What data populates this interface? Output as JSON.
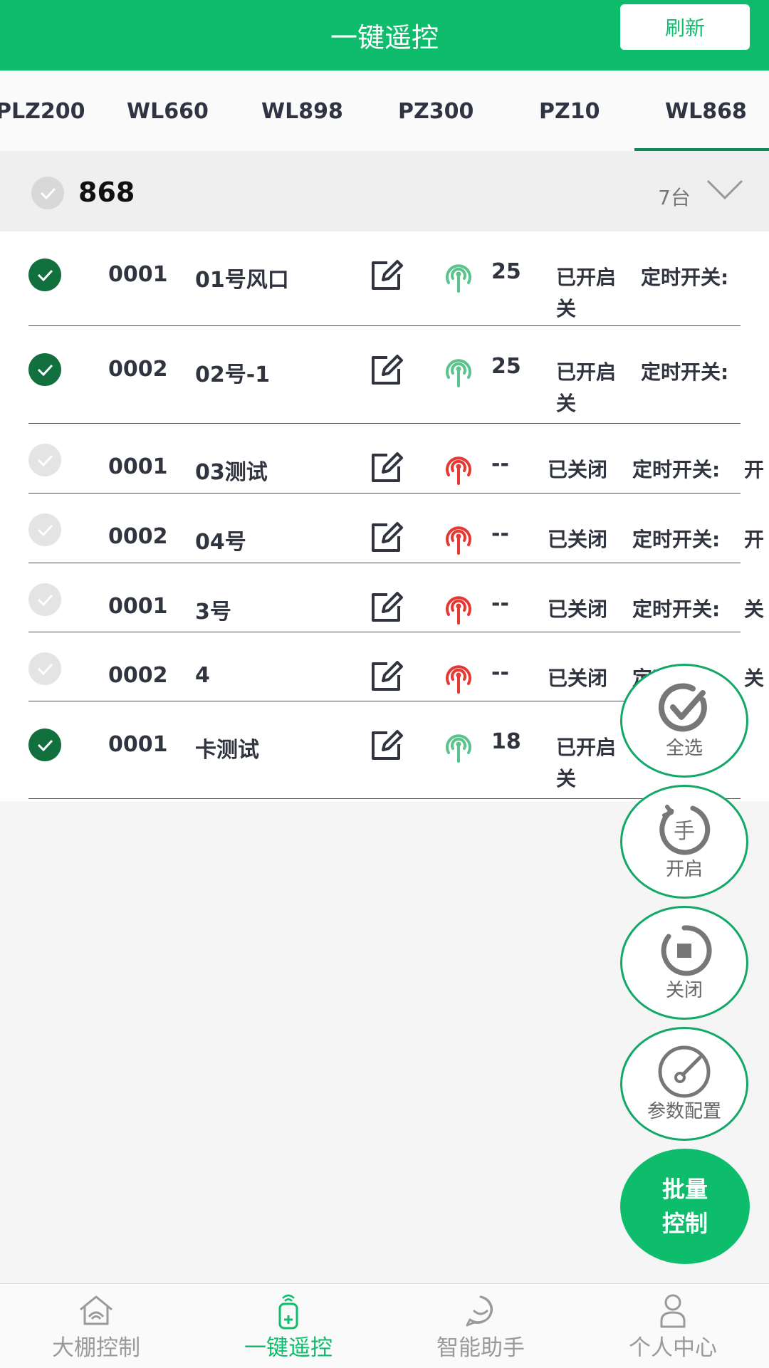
{
  "header": {
    "title": "一键遥控",
    "refresh_label": "刷新"
  },
  "tabs": [
    "PLZ200",
    "WL660",
    "WL898",
    "PZ300",
    "PZ10",
    "WL868"
  ],
  "active_tab": "WL868",
  "group": {
    "name": "868",
    "count": "7台"
  },
  "devices": [
    {
      "checked": true,
      "code": "0001",
      "name": "01号风口",
      "signal": "good",
      "value": "25",
      "status": "已开启",
      "timer_label": "定时开关:",
      "timer_value": "关"
    },
    {
      "checked": true,
      "code": "0002",
      "name": "02号-1",
      "signal": "good",
      "value": "25",
      "status": "已开启",
      "timer_label": "定时开关:",
      "timer_value": "关"
    },
    {
      "checked": false,
      "code": "0001",
      "name": "03测试",
      "signal": "bad",
      "value": "--",
      "status": "已关闭",
      "timer_label": "定时开关:",
      "timer_value": "开"
    },
    {
      "checked": false,
      "code": "0002",
      "name": "04号",
      "signal": "bad",
      "value": "--",
      "status": "已关闭",
      "timer_label": "定时开关:",
      "timer_value": "开"
    },
    {
      "checked": false,
      "code": "0001",
      "name": "3号",
      "signal": "bad",
      "value": "--",
      "status": "已关闭",
      "timer_label": "定时开关:",
      "timer_value": "关"
    },
    {
      "checked": false,
      "code": "0002",
      "name": "4",
      "signal": "bad",
      "value": "--",
      "status": "已关闭",
      "timer_label": "定时开关:",
      "timer_value": "关"
    },
    {
      "checked": true,
      "code": "0001",
      "name": "卡测试",
      "signal": "good",
      "value": "18",
      "status": "已开启",
      "timer_label": "定时开关:",
      "timer_value": "关"
    }
  ],
  "fabs": {
    "select_all": "全选",
    "open": "开启",
    "open_glyph": "手",
    "close": "关闭",
    "config": "参数配置",
    "batch_line1": "批量",
    "batch_line2": "控制"
  },
  "nav": [
    {
      "label": "大棚控制",
      "icon": "greenhouse-icon"
    },
    {
      "label": "一键遥控",
      "icon": "remote-icon"
    },
    {
      "label": "智能助手",
      "icon": "chat-icon"
    },
    {
      "label": "个人中心",
      "icon": "user-icon"
    }
  ],
  "nav_active_index": 1,
  "colors": {
    "brand": "#0dbd6c",
    "check_on": "#12703f",
    "signal_good": "#5bc48c",
    "signal_bad": "#e53935"
  }
}
